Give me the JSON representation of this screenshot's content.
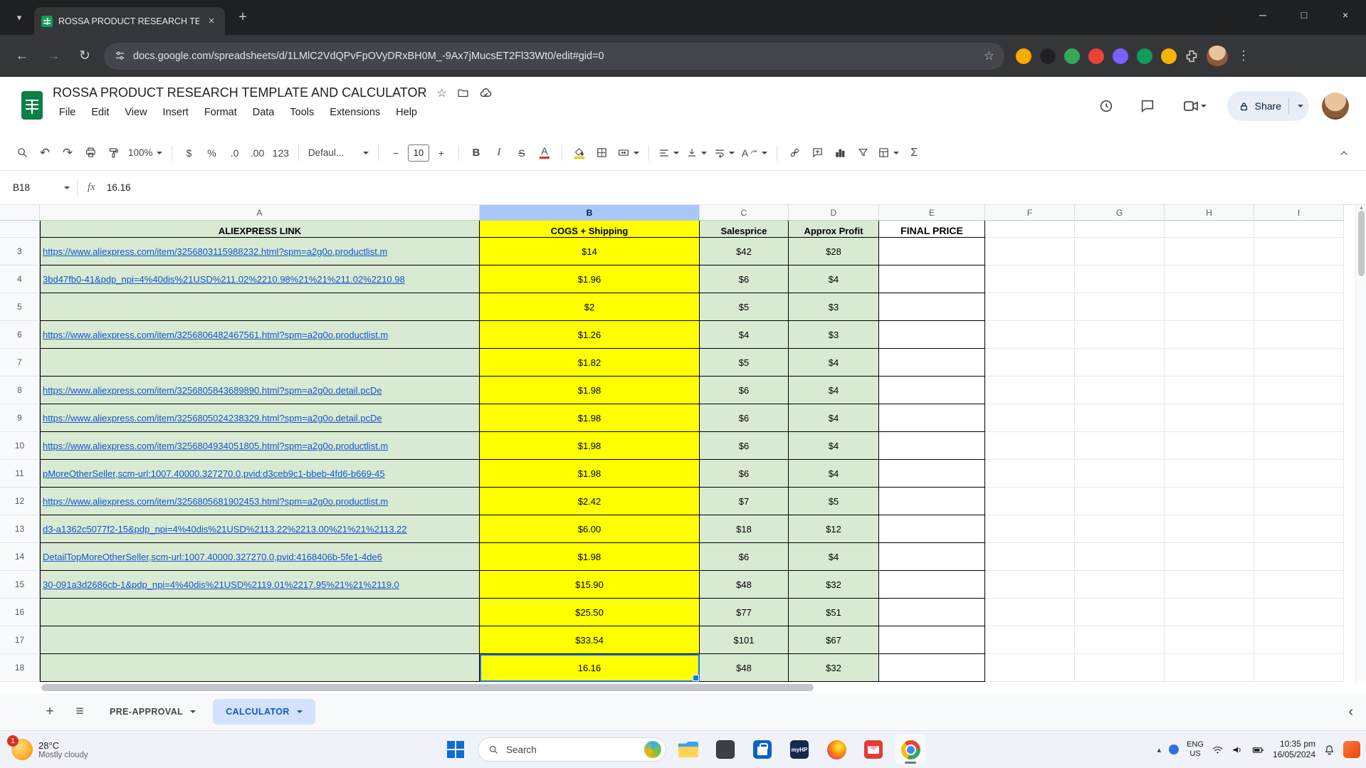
{
  "colors": {
    "accent_blue": "#1a73e8",
    "link_blue": "#1155cc",
    "cell_green": "#d9ead3",
    "cell_yellow": "#ffff00",
    "active_sheet_tab_bg": "#d3e3fd",
    "active_sheet_tab_text": "#0b57d0",
    "text_color_underline": "#d93025",
    "fill_color_underline": "#ffff00"
  },
  "browser": {
    "tab_title": "ROSSA PRODUCT RESEARCH TE",
    "url": "docs.google.com/spreadsheets/d/1LMlC2VdQPvFpOVyDRxBH0M_-9Ax7jMucsET2Fl33Wt0/edit#gid=0",
    "extension_colors": [
      "#f9ab00",
      "#202124",
      "#34a853",
      "#ea4335",
      "#7b61ff",
      "#0f9d58",
      "#f4b400"
    ]
  },
  "sheets": {
    "doc_title": "ROSSA PRODUCT RESEARCH TEMPLATE AND CALCULATOR",
    "menus": [
      "File",
      "Edit",
      "View",
      "Insert",
      "Format",
      "Data",
      "Tools",
      "Extensions",
      "Help"
    ],
    "share_label": "Share",
    "toolbar": {
      "zoom": "100%",
      "currency": "$",
      "percent": "%",
      "decrease_decimal": ".0",
      "increase_decimal": ".00",
      "number_format": "123",
      "font": "Defaul...",
      "minus": "−",
      "font_size": "10",
      "plus": "+",
      "bold": "B",
      "italic": "I",
      "strikethrough": "S",
      "text_color": "A",
      "functions": "Σ"
    }
  },
  "formula_bar": {
    "cell_ref": "B18",
    "fx": "fx",
    "value": "16.16"
  },
  "grid": {
    "col_letters": [
      "A",
      "B",
      "C",
      "D",
      "E",
      "F",
      "G",
      "H",
      "I"
    ],
    "selected_col": "B",
    "selected_row": "18",
    "headers": {
      "a": "ALIEXPRESS LINK",
      "b": "COGS + Shipping",
      "c": "Salesprice",
      "d": "Approx Profit",
      "e": "FINAL PRICE"
    },
    "rows": [
      {
        "n": "3",
        "a": "https://www.aliexpress.com/item/3256803115988232.html?spm=a2g0o.productlist.m",
        "b": "$14",
        "c": "$42",
        "d": "$28"
      },
      {
        "n": "4",
        "a": "3bd47fb0-41&pdp_npi=4%40dis%21USD%211.02%2210.98%21%21%211.02%2210.98",
        "b": "$1.96",
        "c": "$6",
        "d": "$4"
      },
      {
        "n": "5",
        "a": "",
        "b": "$2",
        "c": "$5",
        "d": "$3"
      },
      {
        "n": "6",
        "a": "https://www.aliexpress.com/item/3256806482467561.html?spm=a2g0o.productlist.m",
        "b": "$1.26",
        "c": "$4",
        "d": "$3"
      },
      {
        "n": "7",
        "a": "",
        "b": "$1.82",
        "c": "$5",
        "d": "$4"
      },
      {
        "n": "8",
        "a": "https://www.aliexpress.com/item/3256805843689890.html?spm=a2g0o.detail.pcDe",
        "b": "$1.98",
        "c": "$6",
        "d": "$4"
      },
      {
        "n": "9",
        "a": "https://www.aliexpress.com/item/3256805024238329.html?spm=a2g0o.detail.pcDe",
        "b": "$1.98",
        "c": "$6",
        "d": "$4"
      },
      {
        "n": "10",
        "a": "https://www.aliexpress.com/item/3256804934051805.html?spm=a2g0o.productlist.m",
        "b": "$1.98",
        "c": "$6",
        "d": "$4"
      },
      {
        "n": "11",
        "a": "pMoreOtherSeller,scm-url:1007.40000.327270.0,pvid:d3ceb9c1-bbeb-4fd6-b669-45",
        "b": "$1.98",
        "c": "$6",
        "d": "$4"
      },
      {
        "n": "12",
        "a": "https://www.aliexpress.com/item/3256805681902453.html?spm=a2g0o.productlist.m",
        "b": "$2.42",
        "c": "$7",
        "d": "$5"
      },
      {
        "n": "13",
        "a": "d3-a1362c5077f2-15&pdp_npi=4%40dis%21USD%2113.22%2213.00%21%21%2113.22",
        "b": "$6.00",
        "c": "$18",
        "d": "$12"
      },
      {
        "n": "14",
        "a": "DetailTopMoreOtherSeller,scm-url:1007.40000.327270.0,pvid:4168406b-5fe1-4de6",
        "b": "$1.98",
        "c": "$6",
        "d": "$4"
      },
      {
        "n": "15",
        "a": "30-091a3d2686cb-1&pdp_npi=4%40dis%21USD%2119.01%2217.95%21%21%2119.0",
        "b": "$15.90",
        "c": "$48",
        "d": "$32"
      },
      {
        "n": "16",
        "a": "",
        "b": "$25.50",
        "c": "$77",
        "d": "$51"
      },
      {
        "n": "17",
        "a": "",
        "b": "$33.54",
        "c": "$101",
        "d": "$67"
      },
      {
        "n": "18",
        "a": "",
        "b": "16.16",
        "c": "$48",
        "d": "$32"
      }
    ]
  },
  "sheet_tabs": {
    "tabs": [
      {
        "label": "PRE-APPROVAL",
        "active": false
      },
      {
        "label": "CALCULATOR",
        "active": true
      }
    ]
  },
  "taskbar": {
    "weather": {
      "temp": "28°C",
      "condition": "Mostly cloudy",
      "badge": "1"
    },
    "search_label": "Search",
    "myhp_label": "myHP",
    "tray": {
      "lang_top": "ENG",
      "lang_bottom": "US",
      "time": "10:35 pm",
      "date": "16/05/2024"
    }
  }
}
